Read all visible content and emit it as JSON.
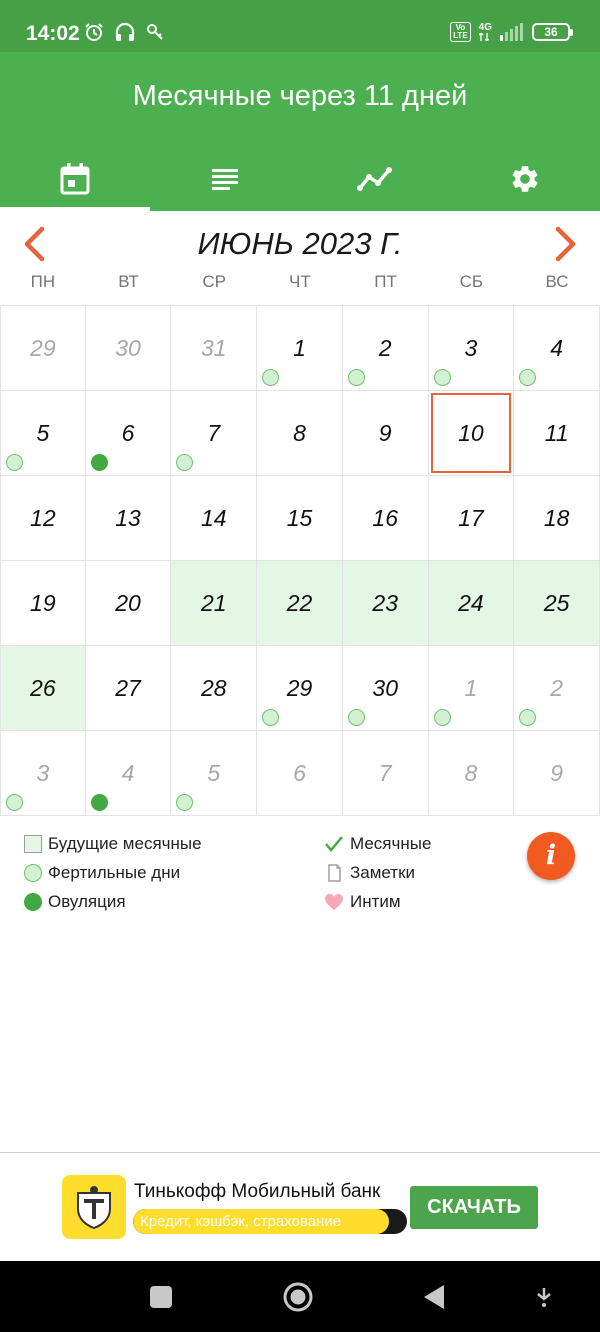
{
  "status_bar": {
    "time": "14:02",
    "volte_top": "Vo",
    "volte_bottom": "LTE",
    "network": "4G",
    "battery": "36"
  },
  "header": {
    "title": "Месячные через 11 дней"
  },
  "tabs": [
    {
      "name": "calendar-icon",
      "active": true
    },
    {
      "name": "list-icon",
      "active": false
    },
    {
      "name": "chart-icon",
      "active": false
    },
    {
      "name": "gear-icon",
      "active": false
    }
  ],
  "calendar": {
    "month_title": "ИЮНЬ 2023 Г.",
    "weekdays": [
      "ПН",
      "ВТ",
      "СР",
      "ЧТ",
      "ПТ",
      "СБ",
      "ВС"
    ],
    "days": [
      {
        "d": "29",
        "other": true
      },
      {
        "d": "30",
        "other": true
      },
      {
        "d": "31",
        "other": true
      },
      {
        "d": "1",
        "dot": "fertile"
      },
      {
        "d": "2",
        "dot": "fertile"
      },
      {
        "d": "3",
        "dot": "fertile"
      },
      {
        "d": "4",
        "dot": "fertile"
      },
      {
        "d": "5",
        "dot": "fertile"
      },
      {
        "d": "6",
        "dot": "ovulation"
      },
      {
        "d": "7",
        "dot": "fertile"
      },
      {
        "d": "8"
      },
      {
        "d": "9"
      },
      {
        "d": "10",
        "today": true
      },
      {
        "d": "11"
      },
      {
        "d": "12"
      },
      {
        "d": "13"
      },
      {
        "d": "14"
      },
      {
        "d": "15"
      },
      {
        "d": "16"
      },
      {
        "d": "17"
      },
      {
        "d": "18"
      },
      {
        "d": "19"
      },
      {
        "d": "20"
      },
      {
        "d": "21",
        "future": true
      },
      {
        "d": "22",
        "future": true
      },
      {
        "d": "23",
        "future": true
      },
      {
        "d": "24",
        "future": true
      },
      {
        "d": "25",
        "future": true
      },
      {
        "d": "26",
        "future": true
      },
      {
        "d": "27"
      },
      {
        "d": "28"
      },
      {
        "d": "29",
        "dot": "fertile"
      },
      {
        "d": "30",
        "dot": "fertile"
      },
      {
        "d": "1",
        "other": true,
        "dot": "fertile"
      },
      {
        "d": "2",
        "other": true,
        "dot": "fertile"
      },
      {
        "d": "3",
        "other": true,
        "dot": "fertile"
      },
      {
        "d": "4",
        "other": true,
        "dot": "ovulation"
      },
      {
        "d": "5",
        "other": true,
        "dot": "fertile"
      },
      {
        "d": "6",
        "other": true
      },
      {
        "d": "7",
        "other": true
      },
      {
        "d": "8",
        "other": true
      },
      {
        "d": "9",
        "other": true
      }
    ]
  },
  "legend": {
    "future_period": "Будущие месячные",
    "fertile_days": "Фертильные дни",
    "ovulation": "Овуляция",
    "period": "Месячные",
    "notes": "Заметки",
    "intimacy": "Интим",
    "info": "i"
  },
  "ad": {
    "title": "Тинькофф Мобильный банк",
    "tagline": "Кредит, кэшбэк, страхование",
    "button": "СКАЧАТЬ"
  },
  "colors": {
    "header": "#4caf50",
    "accent": "#e8623a",
    "future": "#e4f7e4",
    "ovulation": "#43a943"
  }
}
